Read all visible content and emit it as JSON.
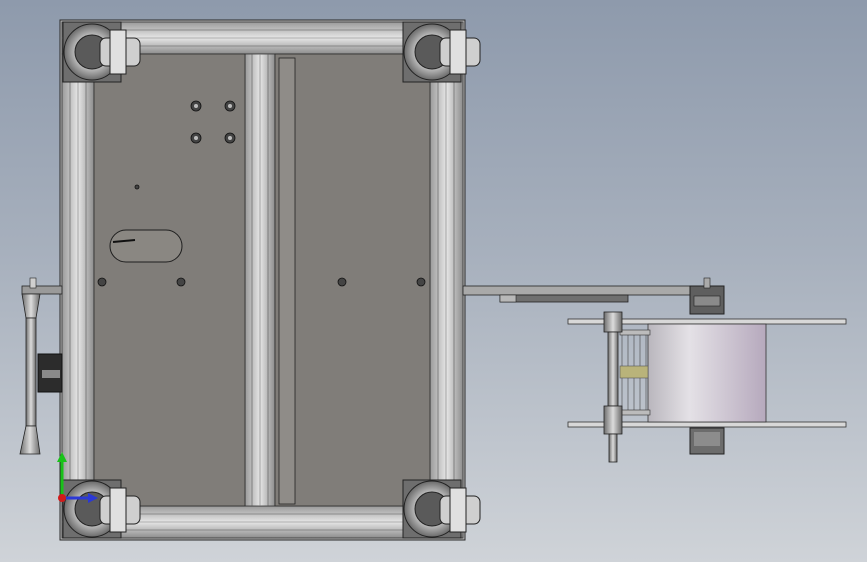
{
  "viewport": {
    "background_top": "#8e9aac",
    "background_bottom": "#cfd3d8"
  },
  "model": {
    "frame_color": "#c7c7c7",
    "panel_color": "#7f7c78",
    "edge_color": "#2a2a2a",
    "drum_color": "#d4d0d8"
  },
  "triad": {
    "y_axis_color": "#19c219",
    "x_axis_color": "#2b38d6",
    "z_axis_color": "#d11a1a"
  }
}
